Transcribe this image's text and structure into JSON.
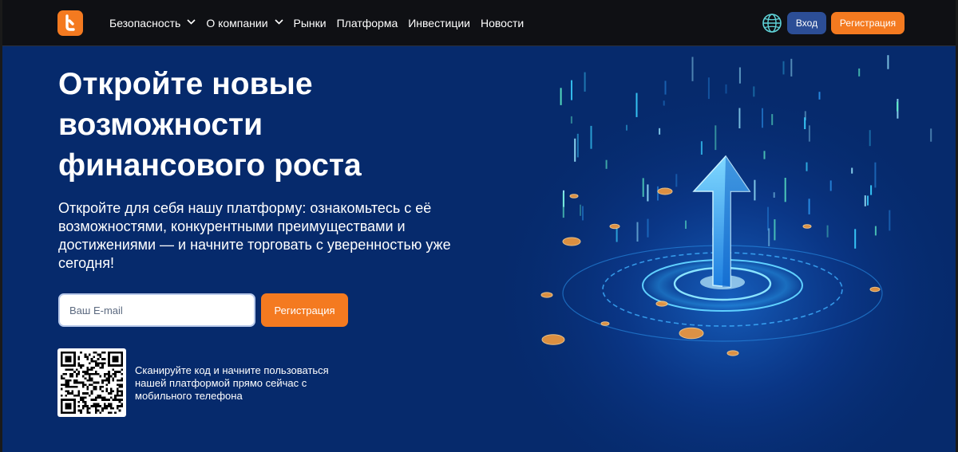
{
  "header": {
    "nav": [
      {
        "label": "Безопасность",
        "dropdown": true
      },
      {
        "label": "О компании",
        "dropdown": true
      },
      {
        "label": "Рынки",
        "dropdown": false
      },
      {
        "label": "Платформа",
        "dropdown": false
      },
      {
        "label": "Инвестиции",
        "dropdown": false
      },
      {
        "label": "Новости",
        "dropdown": false
      }
    ],
    "login_label": "Вход",
    "register_label": "Регистрация"
  },
  "hero": {
    "title": "Откройте новые возможности финансового роста",
    "subtitle": "Откройте для себя нашу платформу: ознакомьтесь с её возможностями, конкурентными преимуществами и достижениями — и начните торговать с уверенностью уже сегодня!",
    "email_placeholder": "Ваш E-mail",
    "register_label": "Регистрация",
    "qr_text": "Сканируйте код и начните пользоваться нашей платформой прямо сейчас с мобильного телефона"
  },
  "colors": {
    "accent": "#f47a20",
    "header_bg": "#0f1014",
    "hero_bg": "#062a6c",
    "login_btn": "#2c4e96"
  },
  "icons": [
    "logo-icon",
    "chevron-down-icon",
    "globe-icon",
    "qr-code",
    "arrow-up-illustration"
  ]
}
